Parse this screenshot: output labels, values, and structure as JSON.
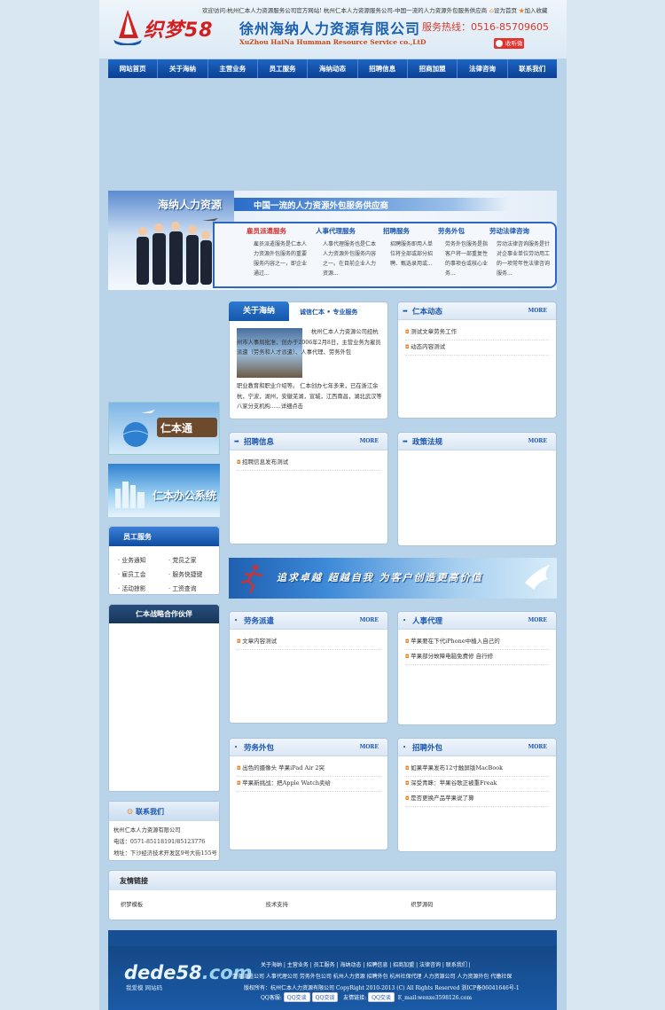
{
  "header": {
    "logo_text": "织梦58",
    "company_name": "徐州海纳人力资源有限公司",
    "company_en": "XuZhou HaiNa Humman Resource Service co.,LtD",
    "welcome": "欢迎访问:杭州仁本人力资源服务公司官方网站! 杭州仁本人力资源服务公司-中国一流的人力资源外包服务供应商",
    "set_home": "设为首页",
    "add_fav": "加入收藏",
    "hotline": "服务热线：0516-85709605",
    "weibo": "收听微"
  },
  "nav": [
    "网站首页",
    "关于海纳",
    "主营业务",
    "员工服务",
    "海纳动态",
    "招聘信息",
    "招商加盟",
    "法律咨询",
    "联系我们"
  ],
  "banner": {
    "title": "海纳人力资源",
    "slogan": "中国一流的人力资源外包服务供应商",
    "services": [
      {
        "title": "雇员派遣服务",
        "desc": "雇员派遣服务是仁本人力资源外包服务的重要服务内容之一，即企业通过..."
      },
      {
        "title": "人事代理服务",
        "desc": "人事代理服务也是仁本人力资源外包服务内容之一。在目前企业人力资源..."
      },
      {
        "title": "招聘服务",
        "desc": "招聘服务即用人单位将全部或部分招聘、甄选录用或..."
      },
      {
        "title": "劳务外包",
        "desc": "劳务外包服务是指客户将一部重复性的事项仓或核心业务..."
      },
      {
        "title": "劳动法律咨询",
        "desc": "劳动法律咨询服务是针对企事业单位劳动用工的一项常年性法律咨询服务..."
      }
    ]
  },
  "left": {
    "ad1": "仁本通",
    "ad2": "仁本办公系统",
    "staff_title": "员工服务",
    "staff_items": [
      "业务通知",
      "党员之家",
      "雇员工会",
      "服务快捷键",
      "活动掠影",
      "工资查询"
    ],
    "partner_title": "仁本战略合作伙伴",
    "contact_title": "联系我们",
    "contact": [
      "杭州仁本人力资源有限公司",
      "电话：0571-85118191/85123776",
      "地址：下沙经济技术开发区9号大街155号"
    ]
  },
  "about": {
    "tab": "关于海纳",
    "sub": "诚信仁本 • 专业服务",
    "text": "杭州仁本人力资源公司经杭州市人事局批准，创办于2006年2月8日，主营业务为雇员派遣（劳务和人才派遣）、人事代理、劳务外包",
    "text2": "职业教育和职业介绍等。 仁本创办七年多来，已在浙江余杭，宁波，湖州，安徽芜湖，宣城，江西南昌，湖北武汉等八家分支机构......详细点击"
  },
  "boxes": {
    "news": {
      "title": "仁本动态",
      "more": "MORE",
      "items": [
        "测试文章劳务工作",
        "动态内容测试"
      ]
    },
    "recruit": {
      "title": "招聘信息",
      "more": "MORE",
      "items": [
        "招聘信息发布测试"
      ]
    },
    "policy": {
      "title": "政策法规",
      "more": "MORE",
      "items": []
    },
    "dispatch": {
      "title": "劳务派遣",
      "more": "MORE",
      "items": [
        "文章内容测试"
      ]
    },
    "agent": {
      "title": "人事代理",
      "more": "MORE",
      "items": [
        "苹果要在下代iPhone中植入自己的",
        "苹果部分故障电脑免费修 自行修"
      ]
    },
    "outsource": {
      "title": "劳务外包",
      "more": "MORE",
      "items": [
        "出色的摄像头 苹果iPad Air 2突",
        "苹果新挑战：把Apple Watch卖给"
      ]
    },
    "recruit2": {
      "title": "招聘外包",
      "more": "MORE",
      "items": [
        "如果苹果发布12寸触屏版MacBook",
        "深受青睐：苹果谷歌正被重Freak",
        "是否更换产品苹果说了算"
      ]
    }
  },
  "wide_banner": "追求卓越  超越自我  为客户创造更高价值",
  "links": {
    "title": "友情链接",
    "items": [
      "织梦模板",
      "技术支持",
      "织梦源码"
    ]
  },
  "footer": {
    "logo": "dede58",
    "logo_suffix": ".com",
    "logo_sub": "我爱模 网站码",
    "nav": "关于海纳 | 主营业务 | 员工服务 | 海纳动态 | 招聘信息 | 招商加盟 | 法律咨询 | 联系我们 |",
    "line2": "劳务派遣公司 人事代理公司 劳务外包公司 杭州人力资源 招聘外包 杭州社保代理 人力资源公司 人力资源外包 代缴社保",
    "copyright": "版权所有：杭州仁本人力资源有限公司 CopyRight 2010-2013 (C) All Rights Reserved 浙ICP备06041646号-1",
    "qq_label": "QQ客服:",
    "qq_btn": "QQ交谈",
    "friend_label": "友情链接:",
    "email": "E_mail:wenxe3598126.com"
  }
}
